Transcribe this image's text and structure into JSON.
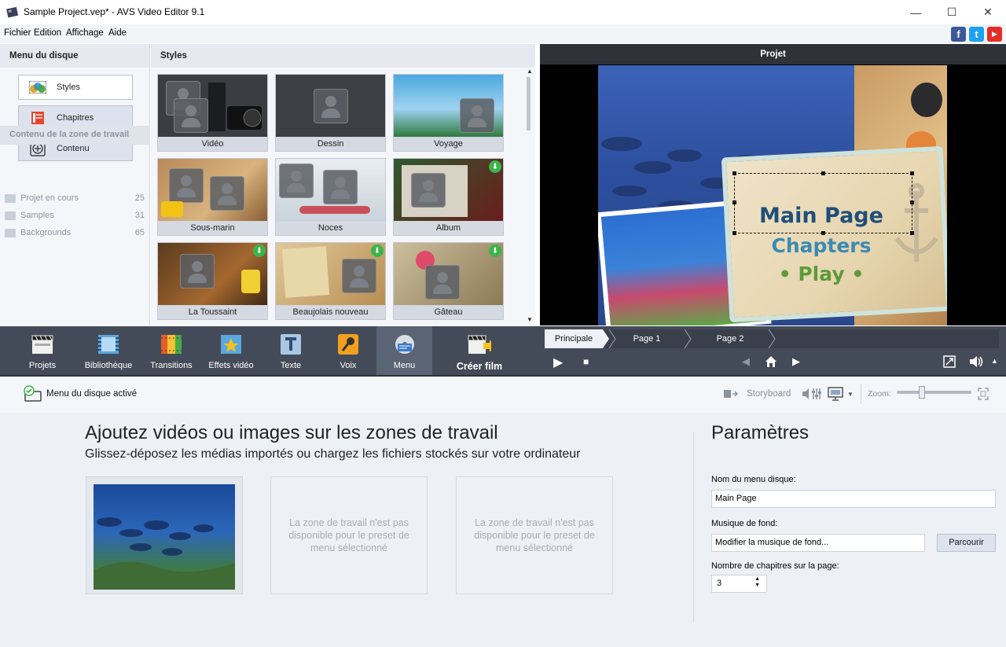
{
  "window": {
    "title": "Sample Project.vep* - AVS Video Editor 9.1",
    "controls": [
      "—",
      "☐",
      "✕"
    ]
  },
  "menubar": {
    "items": [
      "Fichier",
      "Edition",
      "Affichage",
      "Aide"
    ]
  },
  "social": [
    "f",
    "t",
    "▶"
  ],
  "left_panel": {
    "title": "Menu du disque",
    "buttons": [
      "Styles",
      "Chapitres",
      "Contenu"
    ],
    "content_title": "Contenu de la zone de travail",
    "content_items": [
      {
        "label": "Projet en cours",
        "count": "25"
      },
      {
        "label": "Samples",
        "count": "31"
      },
      {
        "label": "Backgrounds",
        "count": "65"
      }
    ]
  },
  "styles_panel": {
    "title": "Styles",
    "items": [
      "Vidéo",
      "Dessin",
      "Voyage",
      "Sous-marin",
      "Noces",
      "Album",
      "La Toussaint",
      "Beaujolais nouveau",
      "Gâteau"
    ]
  },
  "preview": {
    "title": "Projet",
    "menu_text": {
      "main": "Main Page",
      "chapters": "Chapters",
      "play": "• Play •"
    }
  },
  "toolbar": {
    "tools": [
      "Projets",
      "Bibliothèque",
      "Transitions",
      "Effets vidéo",
      "Texte",
      "Voix",
      "Menu"
    ],
    "create": "Créer film",
    "tabs": [
      "Principale",
      "Page 1",
      "Page 2"
    ]
  },
  "storyboard_bar": {
    "status": "Menu du disque activé",
    "storyboard": "Storyboard",
    "zoom": "Zoom:"
  },
  "main": {
    "heading": "Ajoutez vidéos ou images sur les zones de travail",
    "subheading": "Glissez-déposez les médias importés ou chargez les fichiers stockés sur votre ordinateur",
    "unavailable": "La zone de travail  n'est pas disponible pour le preset de menu sélectionné"
  },
  "params": {
    "title": "Paramètres",
    "name_label": "Nom du menu disque:",
    "name_value": "Main Page",
    "music_label": "Musique de fond:",
    "music_value": "Modifier la musique de fond...",
    "browse": "Parcourir",
    "chapters_label": "Nombre de chapitres sur la page:",
    "chapters_value": "3"
  }
}
